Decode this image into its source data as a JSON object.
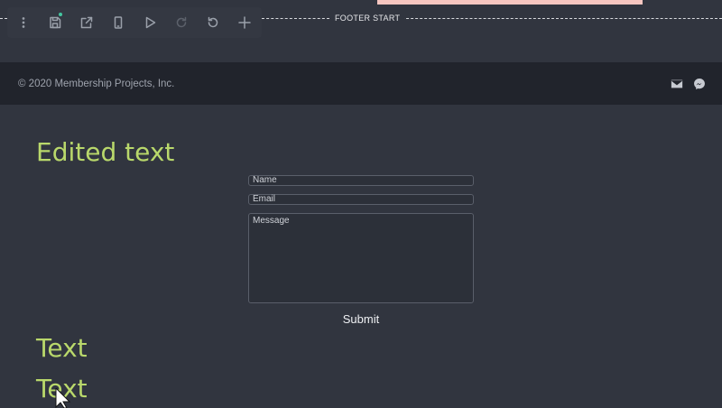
{
  "toolbar": {
    "items": [
      {
        "name": "more-options",
        "icon": "vertical-dots-icon"
      },
      {
        "name": "save",
        "icon": "floppy-disk-icon",
        "status_dot": true
      },
      {
        "name": "open-external",
        "icon": "external-link-icon"
      },
      {
        "name": "mobile-preview",
        "icon": "phone-icon"
      },
      {
        "name": "preview-play",
        "icon": "play-icon"
      },
      {
        "name": "redo",
        "icon": "redo-icon",
        "disabled": true
      },
      {
        "name": "undo",
        "icon": "undo-icon"
      },
      {
        "name": "add",
        "icon": "plus-icon"
      }
    ]
  },
  "divider": {
    "label": "FOOTER START"
  },
  "footer": {
    "copyright": "© 2020 Membership Projects, Inc.",
    "icons": [
      "email-icon",
      "messenger-icon"
    ]
  },
  "main": {
    "heading": "Edited text",
    "form": {
      "name_placeholder": "Name",
      "email_placeholder": "Email",
      "message_placeholder": "Message",
      "submit_label": "Submit"
    },
    "text_blocks": [
      "Text",
      "Text"
    ]
  },
  "colors": {
    "background": "#31353f",
    "footer_bar": "#21242c",
    "accent_text": "#b9d86b",
    "pink_block": "#f7c6c0",
    "status_dot": "#43c6a0"
  }
}
